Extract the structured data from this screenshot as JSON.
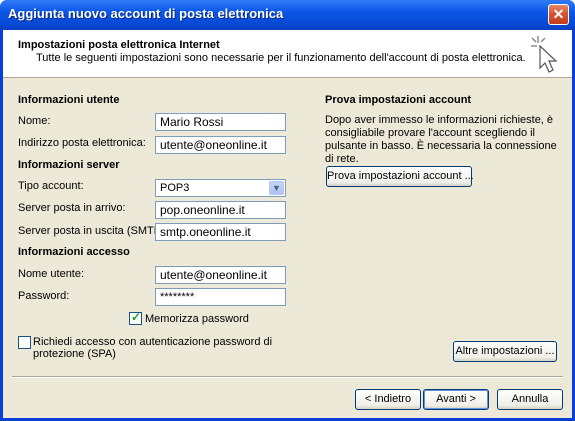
{
  "window": {
    "title": "Aggiunta nuovo account di posta elettronica",
    "close_glyph": "✕"
  },
  "header": {
    "title": "Impostazioni posta elettronica Internet",
    "description": "Tutte le seguenti impostazioni sono necessarie per il funzionamento dell'account di posta elettronica.",
    "icon": "cursor-sparkle-icon"
  },
  "user_info": {
    "section": "Informazioni utente",
    "name_label": "Nome:",
    "name_value": "Mario Rossi",
    "email_label": "Indirizzo posta elettronica:",
    "email_value": "utente@oneonline.it"
  },
  "server_info": {
    "section": "Informazioni server",
    "account_type_label": "Tipo account:",
    "account_type_value": "POP3",
    "incoming_label": "Server posta in arrivo:",
    "incoming_value": "pop.oneonline.it",
    "outgoing_label": "Server posta in uscita (SMTP):",
    "outgoing_value": "smtp.oneonline.it"
  },
  "login_info": {
    "section": "Informazioni accesso",
    "username_label": "Nome utente:",
    "username_value": "utente@oneonline.it",
    "password_label": "Password:",
    "password_value": "********",
    "remember_label": "Memorizza password",
    "remember_checked": true,
    "spa_label": "Richiedi accesso con autenticazione password di protezione (SPA)",
    "spa_checked": false
  },
  "test": {
    "section": "Prova impostazioni account",
    "description": "Dopo aver immesso le informazioni richieste, è consigliabile provare l'account scegliendo il pulsante in basso. È necessaria la connessione di rete.",
    "test_button": "Prova impostazioni account ...",
    "more_settings_button": "Altre impostazioni ..."
  },
  "footer": {
    "back_button": "< Indietro",
    "next_button": "Avanti >",
    "cancel_button": "Annulla"
  },
  "colors": {
    "titlebar": "#0a3fd6",
    "dialog_bg": "#ece9d8"
  }
}
